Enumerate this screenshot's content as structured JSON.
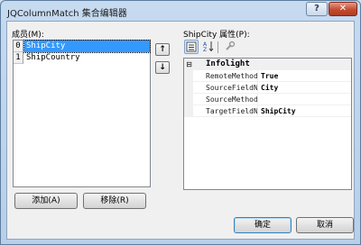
{
  "window": {
    "title": "JQColumnMatch 集合编辑器",
    "help_label": "?",
    "close_label": "✕"
  },
  "members": {
    "label": "成员(M):",
    "items": [
      {
        "index": "0",
        "name": "ShipCity",
        "selected": true
      },
      {
        "index": "1",
        "name": "ShipCountry",
        "selected": false
      }
    ],
    "move_up_label": "↑",
    "move_down_label": "↓",
    "add_label": "添加(A)",
    "remove_label": "移除(R)"
  },
  "properties": {
    "label": "ShipCity 属性(P):",
    "toolbar": {
      "categorized_icon": "categorized-icon",
      "alphabetical_icon": "alphabetical-icon",
      "property-pages-icon": "wrench-icon"
    },
    "category": {
      "toggle": "⊟",
      "name": "Infolight"
    },
    "rows": [
      {
        "name": "RemoteMethod",
        "value": "True"
      },
      {
        "name": "SourceFieldNa",
        "value": "City"
      },
      {
        "name": "SourceMethod",
        "value": ""
      },
      {
        "name": "TargetFieldNa",
        "value": "ShipCity"
      }
    ]
  },
  "footer": {
    "ok_label": "确定",
    "cancel_label": "取消"
  },
  "colors": {
    "selection": "#3399ff",
    "close_button": "#c24b31"
  }
}
